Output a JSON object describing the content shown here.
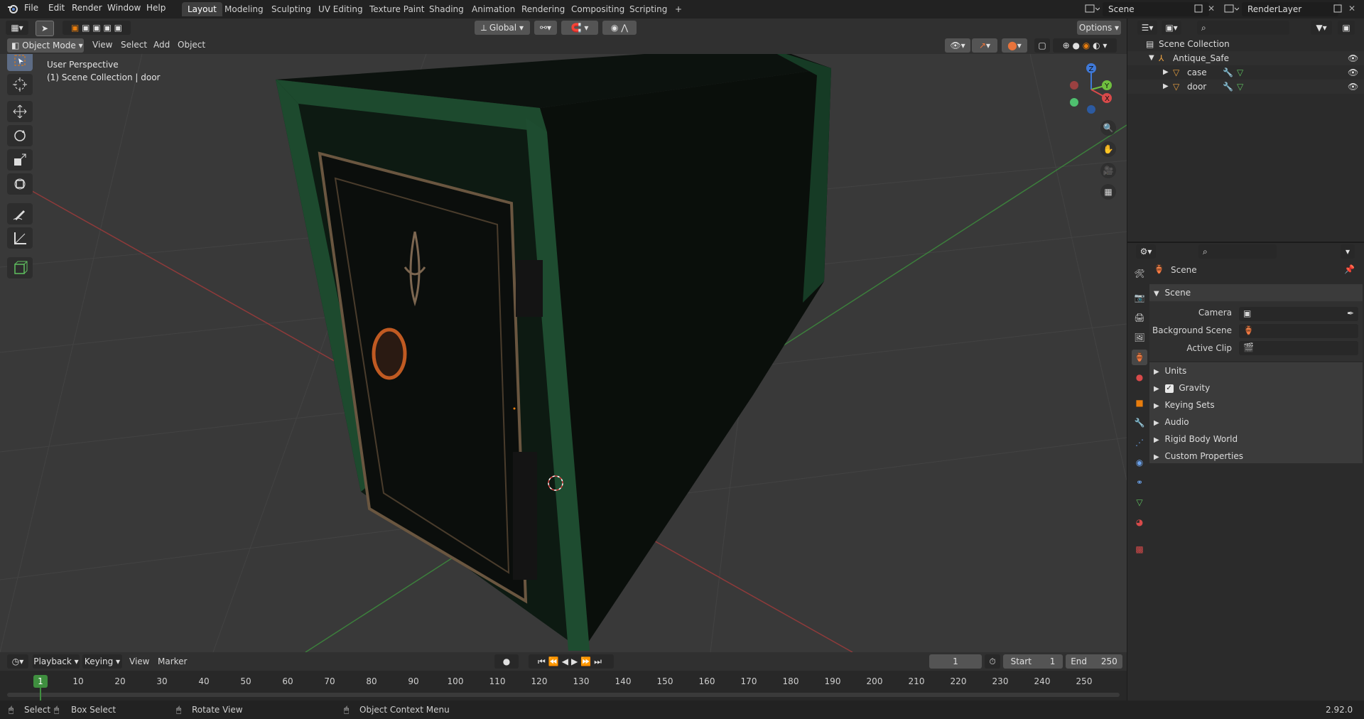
{
  "top_menu": {
    "items": [
      "File",
      "Edit",
      "Render",
      "Window",
      "Help"
    ]
  },
  "workspaces": [
    "Layout",
    "Modeling",
    "Sculpting",
    "UV Editing",
    "Texture Paint",
    "Shading",
    "Animation",
    "Rendering",
    "Compositing",
    "Scripting"
  ],
  "workspace_add": "+",
  "scene_selector": {
    "value": "Scene"
  },
  "view_layer_selector": {
    "value": "RenderLayer"
  },
  "viewport_header": {
    "mode": "Object Mode",
    "menus": [
      "View",
      "Select",
      "Add",
      "Object"
    ],
    "transform_orientation": "Global",
    "options_label": "Options"
  },
  "viewport": {
    "view_name": "User Perspective",
    "context_info": "(1) Scene Collection | door",
    "gizmo_axes": {
      "x": "X",
      "y": "Y",
      "z": "Z"
    }
  },
  "toolbar_tools": [
    "select-box",
    "cursor",
    "move",
    "rotate",
    "scale",
    "transform",
    "annotate",
    "measure",
    "add-cube"
  ],
  "outliner": {
    "root": "Scene Collection",
    "items": [
      {
        "name": "Antique_Safe",
        "level": 1
      },
      {
        "name": "case",
        "level": 2
      },
      {
        "name": "door",
        "level": 2
      }
    ]
  },
  "properties": {
    "header_title": "Scene",
    "panel_title": "Scene",
    "fields": [
      {
        "label": "Camera",
        "value": ""
      },
      {
        "label": "Background Scene",
        "value": ""
      },
      {
        "label": "Active Clip",
        "value": ""
      }
    ],
    "subpanels": [
      {
        "label": "Units",
        "checkbox": false
      },
      {
        "label": "Gravity",
        "checkbox": true,
        "checked": true
      },
      {
        "label": "Keying Sets",
        "checkbox": false
      },
      {
        "label": "Audio",
        "checkbox": false
      },
      {
        "label": "Rigid Body World",
        "checkbox": false
      },
      {
        "label": "Custom Properties",
        "checkbox": false
      }
    ]
  },
  "timeline": {
    "menus": [
      "Playback",
      "Keying",
      "View",
      "Marker"
    ],
    "current_frame": "1",
    "start_label": "Start",
    "start_value": "1",
    "end_label": "End",
    "end_value": "250",
    "ticks": [
      "1",
      "10",
      "20",
      "30",
      "40",
      "50",
      "60",
      "70",
      "80",
      "90",
      "100",
      "110",
      "120",
      "130",
      "140",
      "150",
      "160",
      "170",
      "180",
      "190",
      "200",
      "210",
      "220",
      "230",
      "240",
      "250"
    ]
  },
  "status_bar": {
    "items": [
      "Select",
      "Box Select",
      "Rotate View",
      "Object Context Menu"
    ],
    "version": "2.92.0"
  },
  "colors": {
    "accent_orange": "#e87d0d",
    "active_blue": "#5d6c85",
    "safe_green": "#1b4a30",
    "axis_red": "#a83838",
    "axis_green": "#3f8f3f"
  }
}
